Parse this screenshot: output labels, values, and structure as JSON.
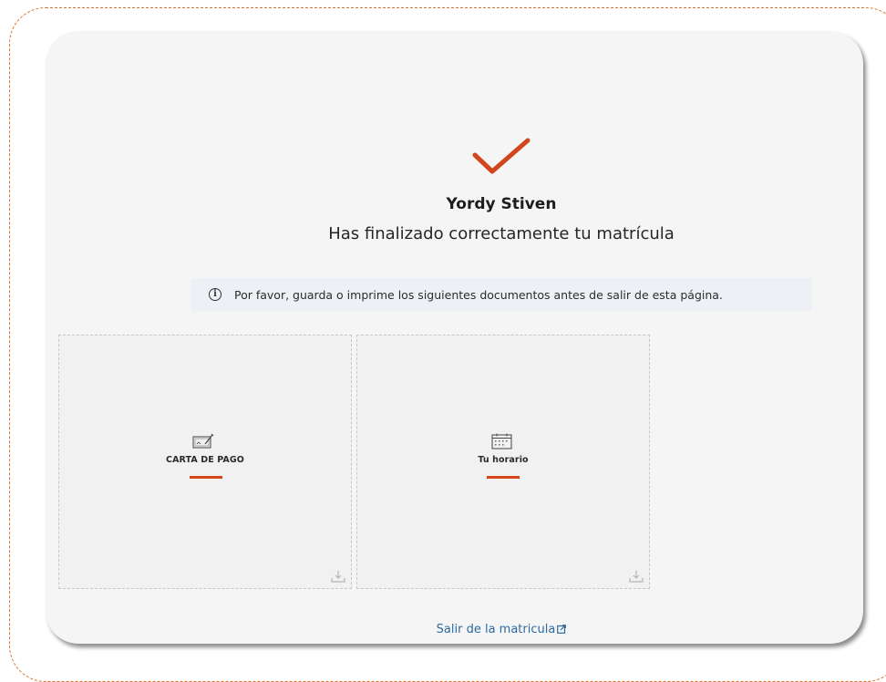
{
  "confirmation": {
    "student_name": "Yordy Stiven",
    "message": "Has finalizado correctamente tu matrícula"
  },
  "notice": {
    "icon": "info-icon",
    "text": "Por favor, guarda o imprime los siguientes documentos antes de salir de esta página."
  },
  "documents": [
    {
      "label": "CARTA DE PAGO",
      "icon": "payment-letter-icon"
    },
    {
      "label": "Tu horario",
      "icon": "calendar-icon"
    }
  ],
  "exit_link": {
    "label": "Salir de la matricula"
  },
  "colors": {
    "accent": "#d1461a",
    "link": "#2d6aa3",
    "card_background": "#f5f5f5",
    "notice_background": "#edf1f6"
  }
}
